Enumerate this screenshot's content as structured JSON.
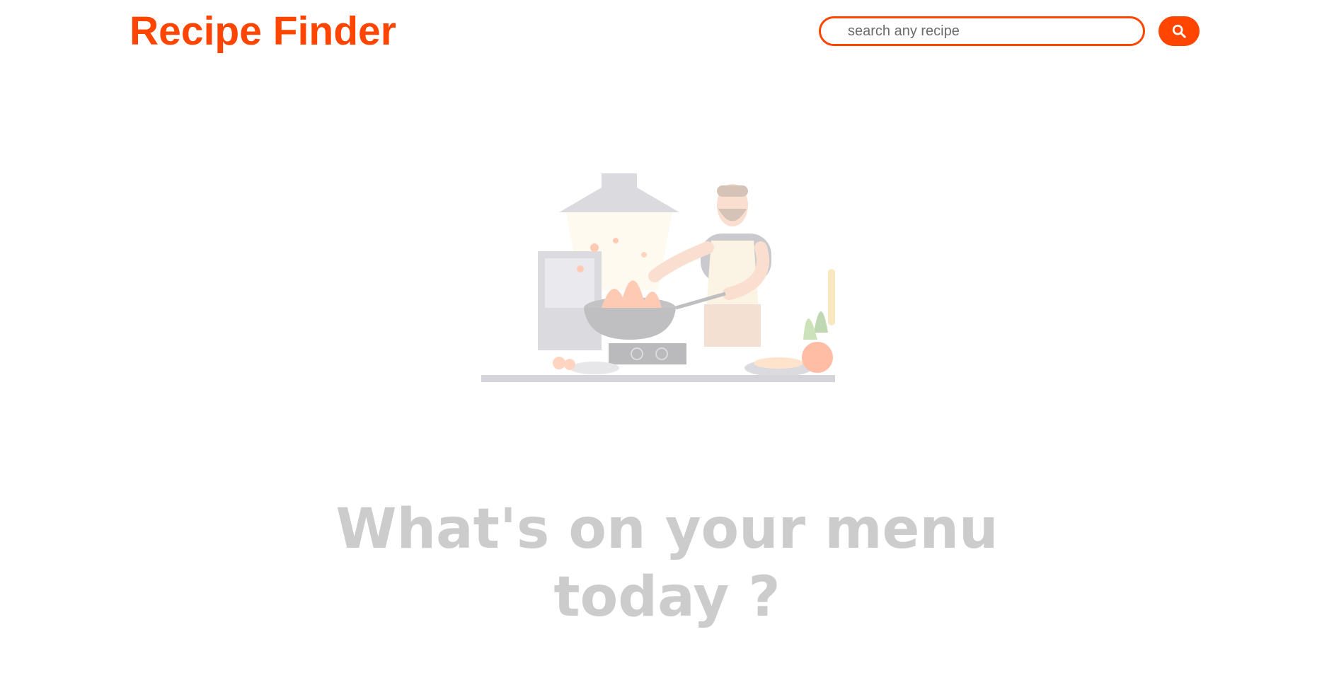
{
  "header": {
    "logo_text": "Recipe Finder",
    "search": {
      "placeholder": "search any recipe",
      "value": "",
      "button_icon": "search-icon"
    }
  },
  "hero": {
    "illustration": "chef-cooking-illustration",
    "tagline_line1": "What's on your menu",
    "tagline_line2": "today ?"
  },
  "colors": {
    "accent": "#ff4500",
    "tagline": "#cccccc",
    "background": "#ffffff"
  }
}
